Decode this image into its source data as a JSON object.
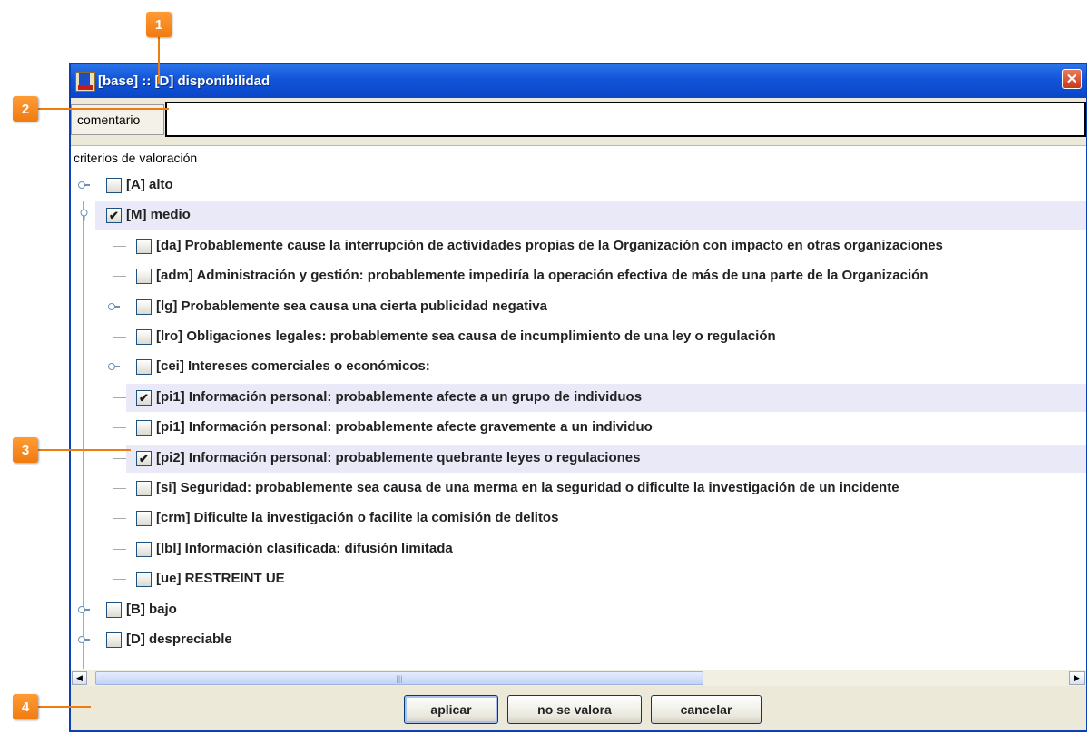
{
  "callouts": [
    "1",
    "2",
    "3",
    "4"
  ],
  "window": {
    "title": "[base] :: [D] disponibilidad",
    "close_symbol": "✕"
  },
  "comment": {
    "label": "comentario",
    "value": "",
    "placeholder": ""
  },
  "tree": {
    "heading": "criterios de valoración",
    "nodes": [
      {
        "label": "[A] alto",
        "checked": false
      },
      {
        "label": "[M] medio",
        "checked": true
      },
      {
        "label": "[da] Probablemente cause la interrupción de actividades propias de la Organización con impacto en otras organizaciones",
        "checked": false
      },
      {
        "label": "[adm] Administración y gestión: probablemente impediría la operación efectiva de más de una parte de la Organización",
        "checked": false
      },
      {
        "label": "[lg] Probablemente sea causa una cierta publicidad negativa",
        "checked": false
      },
      {
        "label": "[lro] Obligaciones legales: probablemente sea causa de incumplimiento de una ley o regulación",
        "checked": false
      },
      {
        "label": "[cei] Intereses comerciales o económicos:",
        "checked": false
      },
      {
        "label": "[pi1] Información personal: probablemente afecte a un grupo de individuos",
        "checked": true
      },
      {
        "label": "[pi1] Información personal: probablemente afecte gravemente a un individuo",
        "checked": false
      },
      {
        "label": "[pi2] Información personal: probablemente quebrante leyes o regulaciones",
        "checked": true
      },
      {
        "label": "[si] Seguridad: probablemente sea causa de una merma en la seguridad o dificulte la investigación de un incidente",
        "checked": false
      },
      {
        "label": "[crm] Dificulte la investigación o facilite la comisión de delitos",
        "checked": false
      },
      {
        "label": "[lbl] Información clasificada: difusión limitada",
        "checked": false
      },
      {
        "label": "[ue] RESTREINT UE",
        "checked": false
      },
      {
        "label": "[B] bajo",
        "checked": false
      },
      {
        "label": "[D] despreciable",
        "checked": false
      }
    ],
    "check_mark": "✔"
  },
  "scrollbar": {
    "left_arrow": "◀",
    "right_arrow": "▶",
    "grip": "|||"
  },
  "buttons": {
    "apply": "aplicar",
    "not_valued": "no se valora",
    "cancel": "cancelar"
  },
  "colors": {
    "titlebar": "#1254d8",
    "callout": "#f07b10",
    "selection": "#e9e9f7"
  }
}
